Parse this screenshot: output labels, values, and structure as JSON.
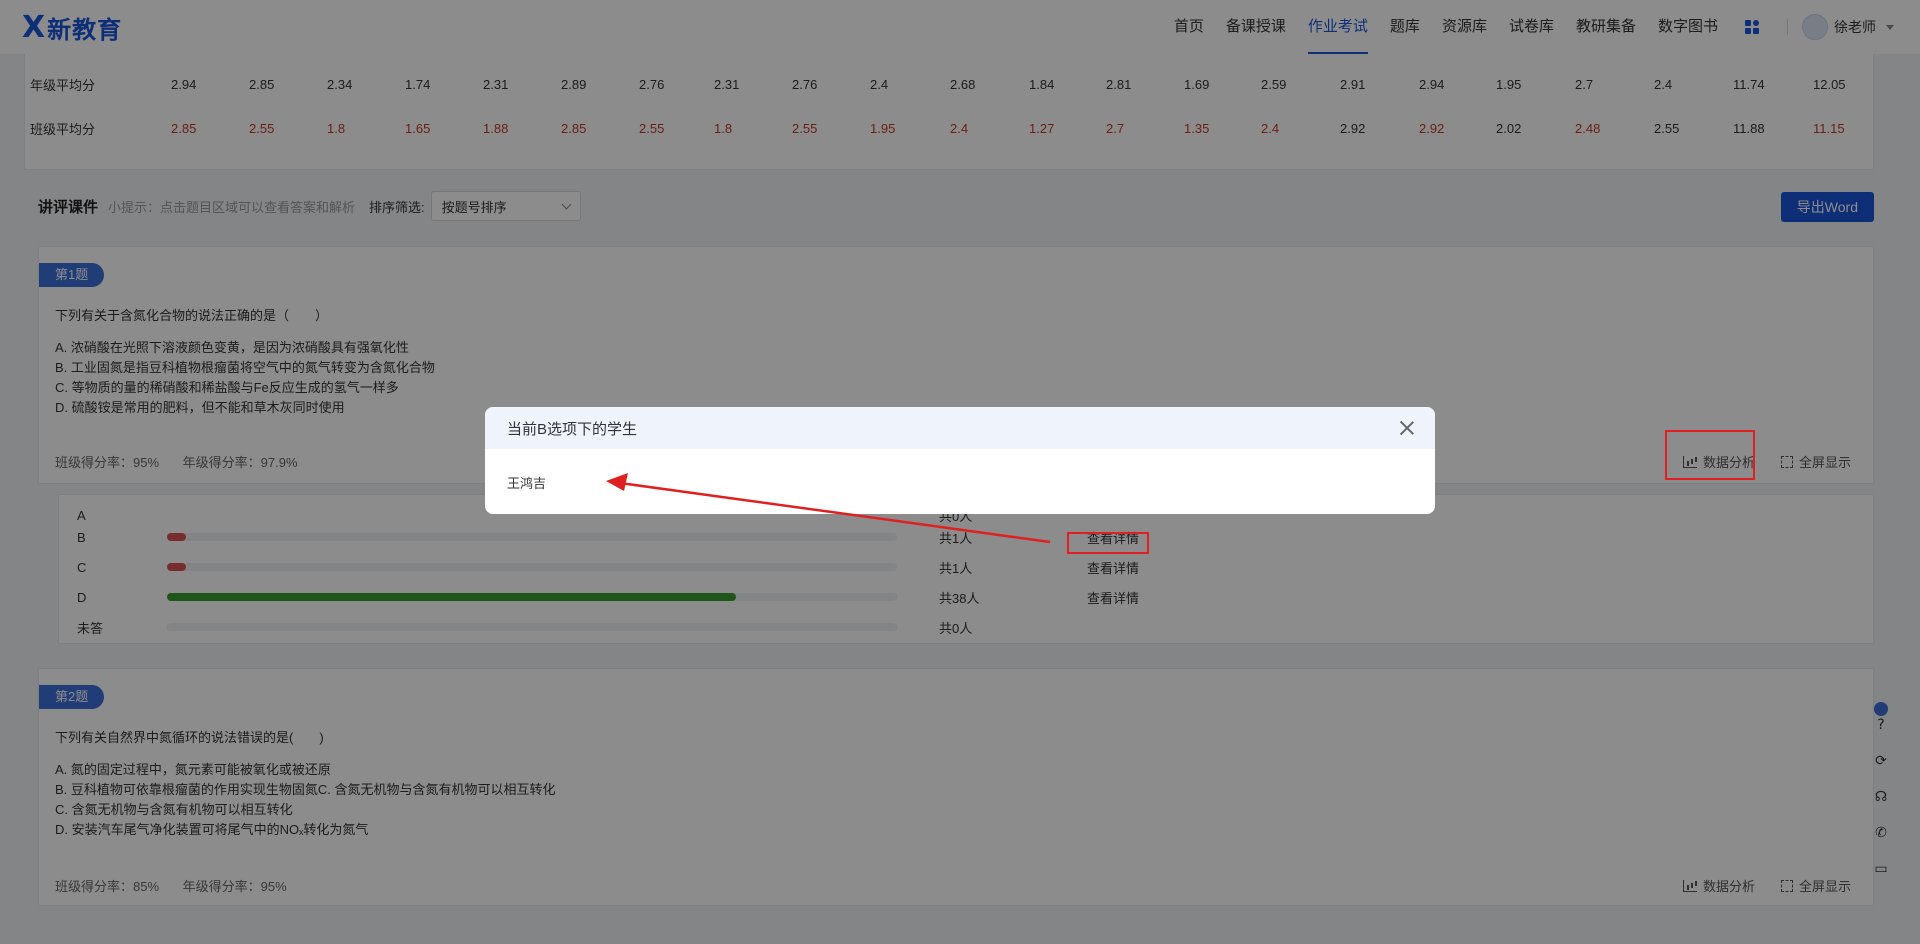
{
  "logo": {
    "mark": "X",
    "text": "新教育"
  },
  "nav": {
    "items": [
      "首页",
      "备课授课",
      "作业考试",
      "题库",
      "资源库",
      "试卷库",
      "教研集备",
      "数字图书"
    ],
    "active": "作业考试",
    "user": "徐老师"
  },
  "stats": {
    "grade_label": "年级平均分",
    "class_label": "班级平均分",
    "grade_values": [
      "2.94",
      "2.85",
      "2.34",
      "1.74",
      "2.31",
      "2.89",
      "2.76",
      "2.31",
      "2.76",
      "2.4",
      "2.68",
      "1.84",
      "2.81",
      "1.69",
      "2.59",
      "2.91",
      "2.94",
      "1.95",
      "2.7",
      "2.4",
      "11.74",
      "12.05"
    ],
    "class_values": [
      "2.85",
      "2.55",
      "1.8",
      "1.65",
      "1.88",
      "2.85",
      "2.55",
      "1.8",
      "2.55",
      "1.95",
      "2.4",
      "1.27",
      "2.7",
      "1.35",
      "2.4",
      "2.92",
      "2.92",
      "2.02",
      "2.48",
      "2.55",
      "11.88",
      "11.15"
    ],
    "class_red": [
      true,
      true,
      true,
      true,
      true,
      true,
      true,
      true,
      true,
      true,
      true,
      true,
      true,
      true,
      true,
      false,
      true,
      false,
      true,
      false,
      false,
      true
    ]
  },
  "section": {
    "title": "讲评课件",
    "hint": "小提示：点击题目区域可以查看答案和解析",
    "sort_label": "排序筛选:",
    "sort_value": "按题号排序",
    "export": "导出Word"
  },
  "q1": {
    "badge": "第1题",
    "text": "下列有关于含氮化合物的说法正确的是（　　）",
    "options": [
      "A. 浓硝酸在光照下溶液颜色变黄，是因为浓硝酸具有强氧化性",
      "B. 工业固氮是指豆科植物根瘤菌将空气中的氮气转变为含氮化合物",
      "C. 等物质的量的稀硝酸和稀盐酸与Fe反应生成的氢气一样多",
      "D. 硫酸铵是常用的肥料，但不能和草木灰同时使用"
    ],
    "class_rate": "班级得分率：95%",
    "grade_rate": "年级得分率：97.9%",
    "analysis": "数据分析",
    "fullscreen": "全屏显示"
  },
  "dist": [
    {
      "label": "A",
      "fraction": 0,
      "color": "#d9534f",
      "count": "共0人",
      "detail": ""
    },
    {
      "label": "B",
      "fraction": 0.026,
      "color": "#d9534f",
      "count": "共1人",
      "detail": "查看详情"
    },
    {
      "label": "C",
      "fraction": 0.026,
      "color": "#d9534f",
      "count": "共1人",
      "detail": "查看详情"
    },
    {
      "label": "D",
      "fraction": 0.78,
      "color": "#3a9b2c",
      "count": "共38人",
      "detail": "查看详情"
    },
    {
      "label": "未答",
      "fraction": 0,
      "color": "#d9534f",
      "count": "共0人",
      "detail": ""
    }
  ],
  "q2": {
    "badge": "第2题",
    "text": "下列有关自然界中氮循环的说法错误的是(　　)",
    "options": [
      "A. 氮的固定过程中，氮元素可能被氧化或被还原",
      "B. 豆科植物可依靠根瘤菌的作用实现生物固氮C. 含氮无机物与含氮有机物可以相互转化",
      "C. 含氮无机物与含氮有机物可以相互转化",
      "D. 安装汽车尾气净化装置可将尾气中的NOₓ转化为氮气"
    ],
    "class_rate": "班级得分率：85%",
    "grade_rate": "年级得分率：95%",
    "analysis": "数据分析",
    "fullscreen": "全屏显示"
  },
  "modal": {
    "title": "当前B选项下的学生",
    "student": "王鸿吉"
  },
  "colors": {
    "accent": "#1a56db",
    "highlight": "#e02020"
  }
}
